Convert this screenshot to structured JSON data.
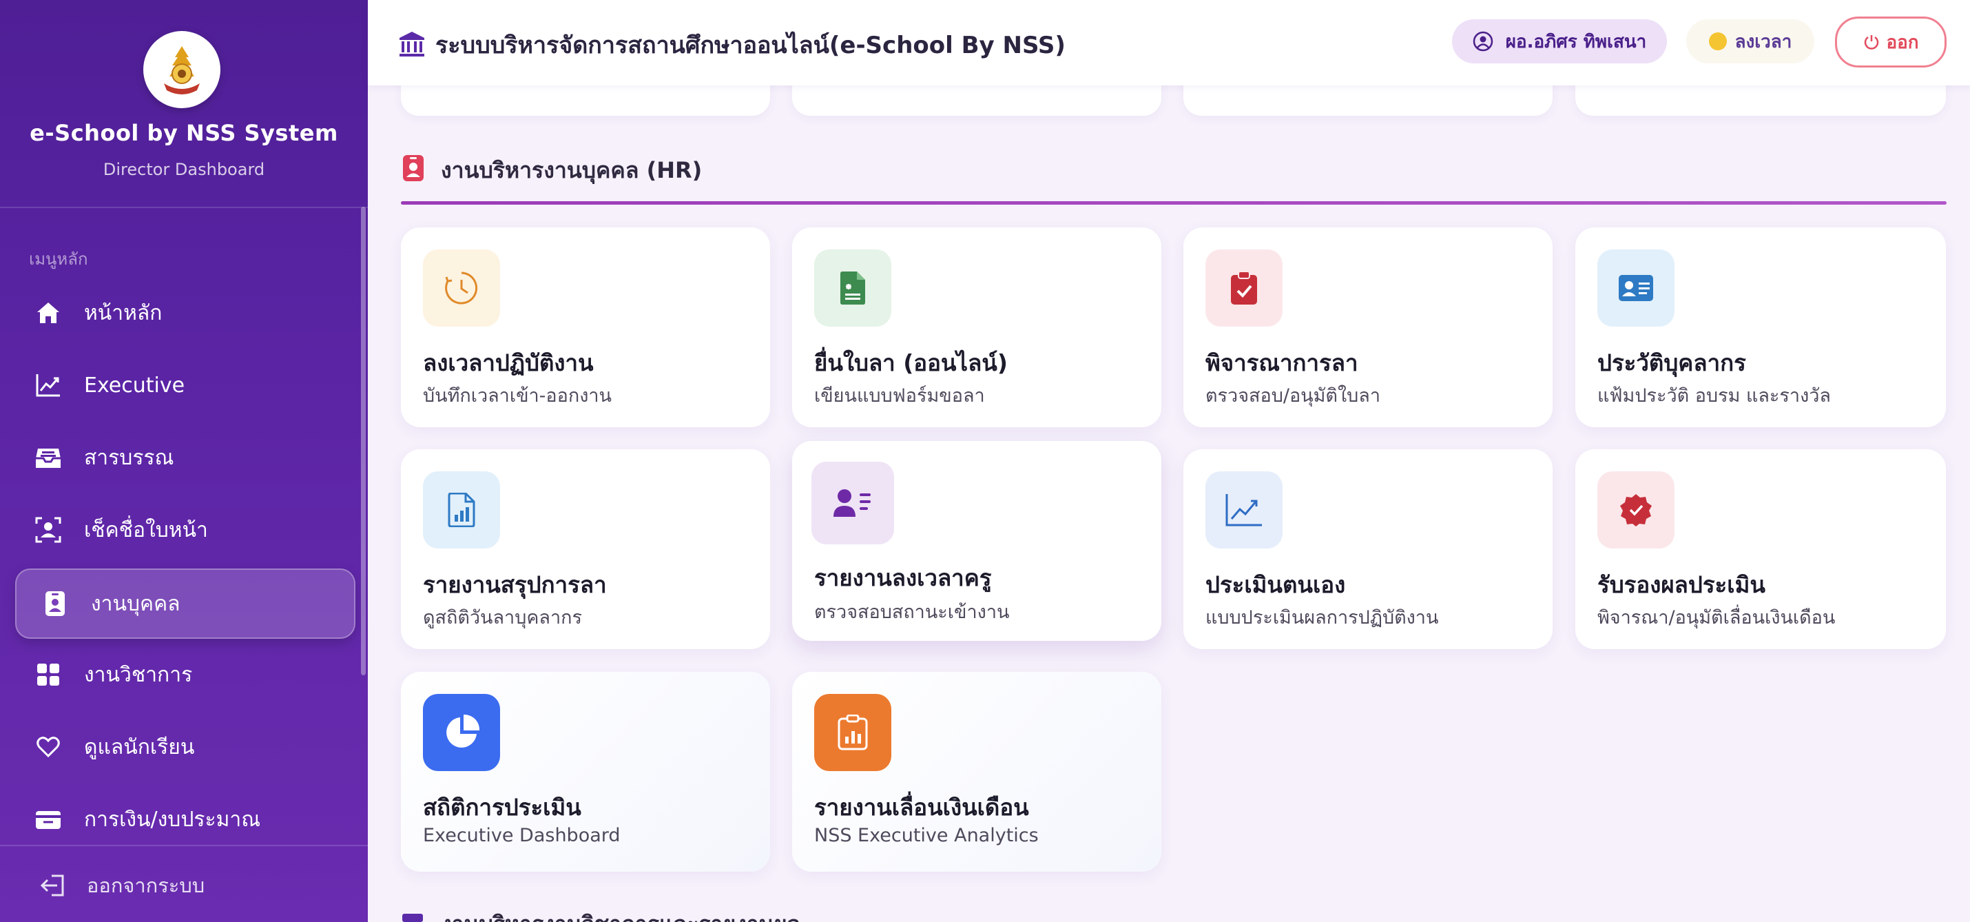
{
  "sidebar": {
    "brand_title": "e-School by NSS System",
    "brand_subtitle": "Director Dashboard",
    "menu_section": "เมนูหลัก",
    "items": [
      {
        "label": "หน้าหลัก",
        "icon": "home-icon"
      },
      {
        "label": "Executive",
        "icon": "chart-line-icon"
      },
      {
        "label": "สารบรรณ",
        "icon": "inbox-icon"
      },
      {
        "label": "เช็คชื่อใบหน้า",
        "icon": "face-scan-icon"
      },
      {
        "label": "งานบุคคล",
        "icon": "id-badge-icon",
        "active": true
      },
      {
        "label": "งานวิชาการ",
        "icon": "grid-icon"
      },
      {
        "label": "ดูแลนักเรียน",
        "icon": "heart-icon"
      },
      {
        "label": "การเงิน/งบประมาณ",
        "icon": "wallet-icon"
      }
    ],
    "logout_label": "ออกจากระบบ"
  },
  "header": {
    "title": "ระบบบริหารจัดการสถานศึกษาออนไลน์(e-School By NSS)",
    "user_name": "ผอ.อภิศร ทิพเสนา",
    "time_label": "ลงเวลา",
    "exit_label": "ออก"
  },
  "section": {
    "title": "งานบริหารงานบุคคล (HR)",
    "accent_color": "#9b3bb7"
  },
  "cards": [
    {
      "title": "ลงเวลาปฏิบัติงาน",
      "subtitle": "บันทึกเวลาเข้า-ออกงาน",
      "icon": "clock-icon"
    },
    {
      "title": "ยื่นใบลา (ออนไลน์)",
      "subtitle": "เขียนแบบฟอร์มขอลา",
      "icon": "file-medical-icon"
    },
    {
      "title": "พิจารณาการลา",
      "subtitle": "ตรวจสอบ/อนุมัติใบลา",
      "icon": "clipboard-check-icon"
    },
    {
      "title": "ประวัติบุคลากร",
      "subtitle": "แฟ้มประวัติ อบรม และรางวัล",
      "icon": "id-card-icon"
    },
    {
      "title": "รายงานสรุปการลา",
      "subtitle": "ดูสถิติวันลาบุคลากร",
      "icon": "file-chart-icon"
    },
    {
      "title": "รายงานลงเวลาครู",
      "subtitle": "ตรวจสอบสถานะเข้างาน",
      "icon": "user-list-icon"
    },
    {
      "title": "ประเมินตนเอง",
      "subtitle": "แบบประเมินผลการปฏิบัติงาน",
      "icon": "trend-chart-icon"
    },
    {
      "title": "รับรองผลประเมิน",
      "subtitle": "พิจารณา/อนุมัติเลื่อนเงินเดือน",
      "icon": "certificate-check-icon"
    },
    {
      "title": "สถิติการประเมิน",
      "subtitle": "Executive Dashboard",
      "icon": "pie-chart-icon"
    },
    {
      "title": "รายงานเลื่อนเงินเดือน",
      "subtitle": "NSS Executive Analytics",
      "icon": "report-chart-icon"
    }
  ],
  "next_section_title": "งานบริหารงานวิชาการและรายงานผล",
  "colors": {
    "sidebar": "#5c25a6",
    "clock_tile": "#fdf3e1",
    "file_tile": "#e6f3e8",
    "clipboard_tile": "#fbe7ea",
    "idcard_tile": "#e2f0fb",
    "pie_tile": "#3b6cf0",
    "report_tile": "#ec7a2e"
  }
}
